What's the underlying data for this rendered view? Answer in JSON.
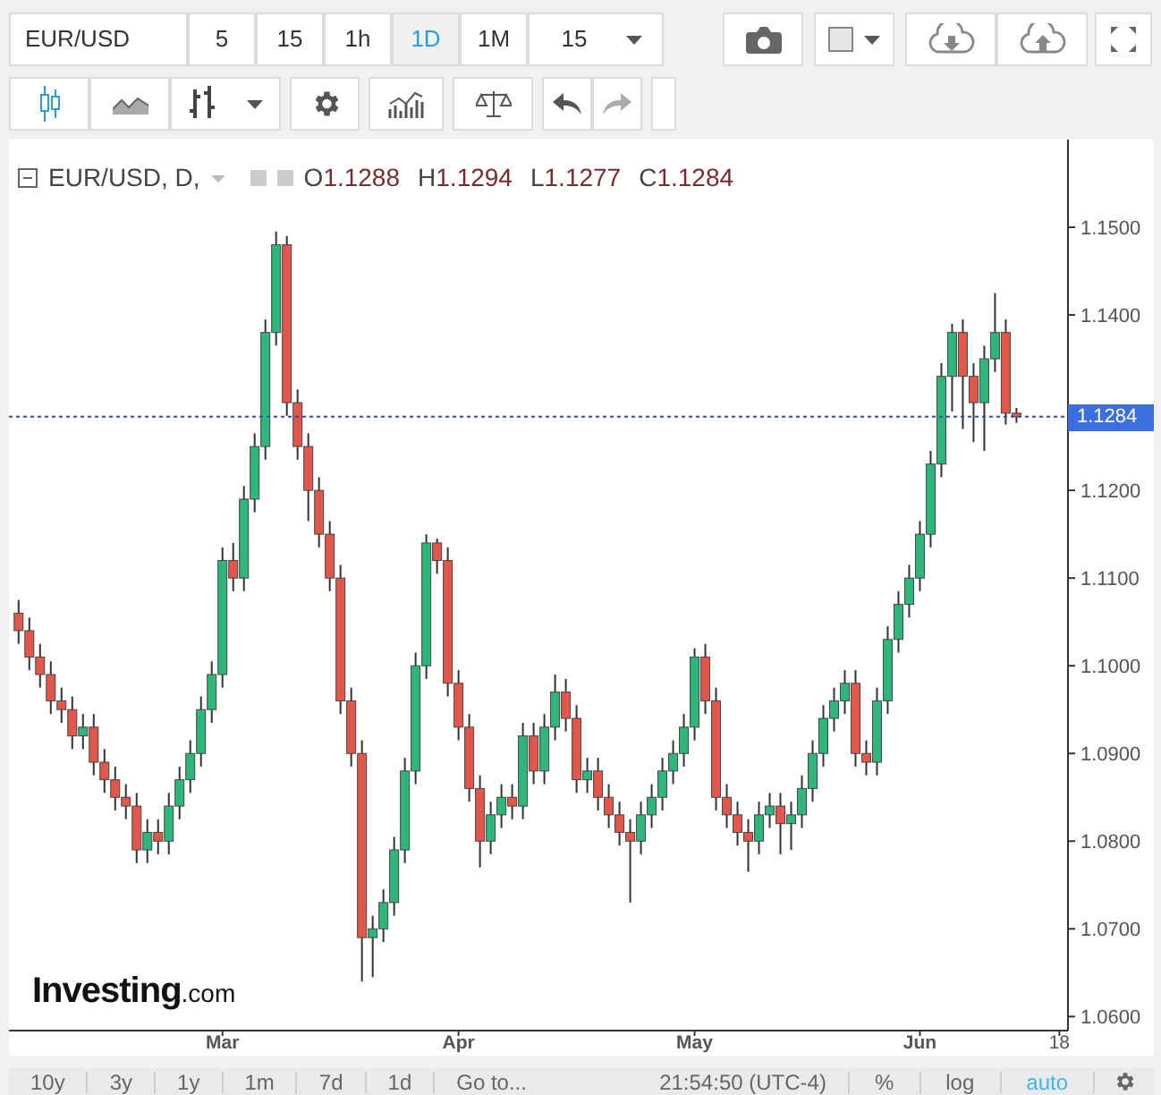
{
  "toolbar": {
    "symbol": "EUR/USD",
    "intervals": [
      {
        "label": "5",
        "selected": false
      },
      {
        "label": "15",
        "selected": false
      },
      {
        "label": "1h",
        "selected": false
      },
      {
        "label": "1D",
        "selected": true
      },
      {
        "label": "1M",
        "selected": false
      }
    ],
    "interval_dropdown": "15"
  },
  "legend": {
    "title": "EUR/USD, D,",
    "values": [
      {
        "label": "O",
        "value": "1.1288"
      },
      {
        "label": "H",
        "value": "1.1294"
      },
      {
        "label": "L",
        "value": "1.1277"
      },
      {
        "label": "C",
        "value": "1.1284"
      }
    ]
  },
  "chart": {
    "current_price": "1.1284",
    "chart_data": {
      "type": "candlestick",
      "categories": [
        null,
        null,
        null,
        null,
        null,
        null,
        null,
        null,
        null,
        null,
        null,
        null,
        null,
        null,
        null,
        null,
        null,
        null,
        null,
        "Mar",
        null,
        null,
        null,
        null,
        null,
        null,
        null,
        null,
        null,
        null,
        null,
        null,
        null,
        null,
        null,
        null,
        null,
        null,
        null,
        null,
        null,
        "Apr",
        null,
        null,
        null,
        null,
        null,
        null,
        null,
        null,
        null,
        null,
        null,
        null,
        null,
        null,
        null,
        null,
        null,
        null,
        null,
        null,
        null,
        "May",
        null,
        null,
        null,
        null,
        null,
        null,
        null,
        null,
        null,
        null,
        null,
        null,
        null,
        null,
        null,
        null,
        null,
        null,
        null,
        null,
        "Jun",
        null,
        null,
        null,
        null,
        null,
        null,
        null,
        null,
        null,
        null,
        null,
        null,
        "18"
      ],
      "ohlc": [
        [
          1.106,
          1.1075,
          1.1025,
          1.104
        ],
        [
          1.104,
          1.1055,
          1.0995,
          1.101
        ],
        [
          1.101,
          1.1025,
          1.0975,
          1.099
        ],
        [
          1.099,
          1.1005,
          1.0945,
          1.096
        ],
        [
          1.096,
          1.0975,
          1.0935,
          1.095
        ],
        [
          1.095,
          1.0965,
          1.0905,
          1.092
        ],
        [
          1.092,
          1.0945,
          1.0905,
          1.093
        ],
        [
          1.093,
          1.0945,
          1.0875,
          1.089
        ],
        [
          1.089,
          1.0905,
          1.0855,
          1.087
        ],
        [
          1.087,
          1.0885,
          1.0835,
          1.085
        ],
        [
          1.085,
          1.0865,
          1.0825,
          1.084
        ],
        [
          1.084,
          1.0855,
          1.0775,
          1.079
        ],
        [
          1.079,
          1.0825,
          1.0775,
          1.081
        ],
        [
          1.081,
          1.0825,
          1.0785,
          1.08
        ],
        [
          1.08,
          1.0855,
          1.0785,
          1.084
        ],
        [
          1.084,
          1.0885,
          1.0825,
          1.087
        ],
        [
          1.087,
          1.0915,
          1.0855,
          1.09
        ],
        [
          1.09,
          1.0965,
          1.0885,
          1.095
        ],
        [
          1.095,
          1.1005,
          1.0935,
          1.099
        ],
        [
          1.099,
          1.1135,
          1.0975,
          1.112
        ],
        [
          1.112,
          1.114,
          1.1085,
          1.11
        ],
        [
          1.11,
          1.1205,
          1.1085,
          1.119
        ],
        [
          1.119,
          1.1265,
          1.1175,
          1.125
        ],
        [
          1.125,
          1.1395,
          1.1235,
          1.138
        ],
        [
          1.138,
          1.1495,
          1.1365,
          1.148
        ],
        [
          1.148,
          1.149,
          1.1285,
          1.13
        ],
        [
          1.13,
          1.1315,
          1.1235,
          1.125
        ],
        [
          1.125,
          1.1265,
          1.1165,
          1.12
        ],
        [
          1.12,
          1.1215,
          1.1135,
          1.115
        ],
        [
          1.115,
          1.1165,
          1.1085,
          1.11
        ],
        [
          1.11,
          1.1115,
          1.0945,
          1.096
        ],
        [
          1.096,
          1.0975,
          1.0885,
          1.09
        ],
        [
          1.09,
          1.0915,
          1.064,
          1.069
        ],
        [
          1.069,
          1.0715,
          1.0645,
          1.07
        ],
        [
          1.07,
          1.0745,
          1.0685,
          1.073
        ],
        [
          1.073,
          1.0805,
          1.0715,
          1.079
        ],
        [
          1.079,
          1.0895,
          1.0775,
          1.088
        ],
        [
          1.088,
          1.1015,
          1.0865,
          1.1
        ],
        [
          1.1,
          1.115,
          1.0985,
          1.114
        ],
        [
          1.114,
          1.1145,
          1.1105,
          1.112
        ],
        [
          1.112,
          1.1135,
          1.0965,
          1.098
        ],
        [
          1.098,
          1.0995,
          1.0915,
          1.093
        ],
        [
          1.093,
          1.0945,
          1.0845,
          1.086
        ],
        [
          1.086,
          1.0875,
          1.077,
          1.08
        ],
        [
          1.08,
          1.0845,
          1.0785,
          1.083
        ],
        [
          1.083,
          1.0865,
          1.0815,
          1.085
        ],
        [
          1.085,
          1.0865,
          1.0825,
          1.084
        ],
        [
          1.084,
          1.0935,
          1.0825,
          1.092
        ],
        [
          1.092,
          1.0935,
          1.0865,
          1.088
        ],
        [
          1.088,
          1.0945,
          1.0865,
          1.093
        ],
        [
          1.093,
          1.099,
          1.0915,
          1.097
        ],
        [
          1.097,
          1.0985,
          1.0925,
          1.094
        ],
        [
          1.094,
          1.0955,
          1.0855,
          1.087
        ],
        [
          1.087,
          1.0895,
          1.0855,
          1.088
        ],
        [
          1.088,
          1.0895,
          1.0835,
          1.085
        ],
        [
          1.085,
          1.0865,
          1.0815,
          1.083
        ],
        [
          1.083,
          1.0845,
          1.0795,
          1.081
        ],
        [
          1.081,
          1.0825,
          1.073,
          1.08
        ],
        [
          1.08,
          1.0845,
          1.0785,
          1.083
        ],
        [
          1.083,
          1.0865,
          1.0815,
          1.085
        ],
        [
          1.085,
          1.0895,
          1.0835,
          1.088
        ],
        [
          1.088,
          1.0915,
          1.0865,
          1.09
        ],
        [
          1.09,
          1.0945,
          1.0885,
          1.093
        ],
        [
          1.093,
          1.102,
          1.0915,
          1.101
        ],
        [
          1.101,
          1.1025,
          1.0945,
          1.096
        ],
        [
          1.096,
          1.0975,
          1.0835,
          1.085
        ],
        [
          1.085,
          1.0865,
          1.0815,
          1.083
        ],
        [
          1.083,
          1.0845,
          1.0795,
          1.081
        ],
        [
          1.081,
          1.0825,
          1.0765,
          1.08
        ],
        [
          1.08,
          1.0845,
          1.0785,
          1.083
        ],
        [
          1.083,
          1.0855,
          1.0815,
          1.084
        ],
        [
          1.084,
          1.0855,
          1.0785,
          1.082
        ],
        [
          1.082,
          1.0845,
          1.079,
          1.083
        ],
        [
          1.083,
          1.0875,
          1.0815,
          1.086
        ],
        [
          1.086,
          1.0915,
          1.0845,
          1.09
        ],
        [
          1.09,
          1.0955,
          1.0885,
          1.094
        ],
        [
          1.094,
          1.0975,
          1.0925,
          1.096
        ],
        [
          1.096,
          1.0995,
          1.0945,
          1.098
        ],
        [
          1.098,
          1.0995,
          1.0885,
          1.09
        ],
        [
          1.09,
          1.0915,
          1.0875,
          1.089
        ],
        [
          1.089,
          1.0975,
          1.0875,
          1.096
        ],
        [
          1.096,
          1.1045,
          1.0945,
          1.103
        ],
        [
          1.103,
          1.1085,
          1.1015,
          1.107
        ],
        [
          1.107,
          1.1115,
          1.1055,
          1.11
        ],
        [
          1.11,
          1.1165,
          1.1085,
          1.115
        ],
        [
          1.115,
          1.1245,
          1.1135,
          1.123
        ],
        [
          1.123,
          1.1345,
          1.1215,
          1.133
        ],
        [
          1.133,
          1.139,
          1.129,
          1.138
        ],
        [
          1.138,
          1.1395,
          1.127,
          1.133
        ],
        [
          1.133,
          1.1345,
          1.1255,
          1.13
        ],
        [
          1.13,
          1.1365,
          1.1245,
          1.135
        ],
        [
          1.135,
          1.1425,
          1.1335,
          1.138
        ],
        [
          1.138,
          1.1395,
          1.1275,
          1.1288
        ],
        [
          1.1288,
          1.1294,
          1.1277,
          1.1284
        ],
        null,
        null,
        null,
        null
      ],
      "ylim": [
        1.0584,
        1.16
      ],
      "ref_lines": [
        {
          "axis": "y",
          "value": 1.1284
        }
      ],
      "yticks": [
        {
          "value": 1.15,
          "label": "1.1500"
        },
        {
          "value": 1.14,
          "label": "1.1400"
        },
        {
          "value": 1.12,
          "label": "1.1200"
        },
        {
          "value": 1.11,
          "label": "1.1100"
        },
        {
          "value": 1.1,
          "label": "1.1000"
        },
        {
          "value": 1.09,
          "label": "1.0900"
        },
        {
          "value": 1.08,
          "label": "1.0800"
        },
        {
          "value": 1.07,
          "label": "1.0700"
        },
        {
          "value": 1.06,
          "label": "1.0600"
        }
      ]
    }
  },
  "logo": {
    "name": "Investing",
    "suffix": ".com"
  },
  "bottom_bar": {
    "ranges": [
      "10y",
      "3y",
      "1y",
      "1m",
      "7d",
      "1d"
    ],
    "goto": "Go to...",
    "time": "21:54:50 (UTC-4)",
    "toggles": [
      {
        "label": "%",
        "on": false
      },
      {
        "label": "log",
        "on": false
      },
      {
        "label": "auto",
        "on": true
      }
    ]
  }
}
